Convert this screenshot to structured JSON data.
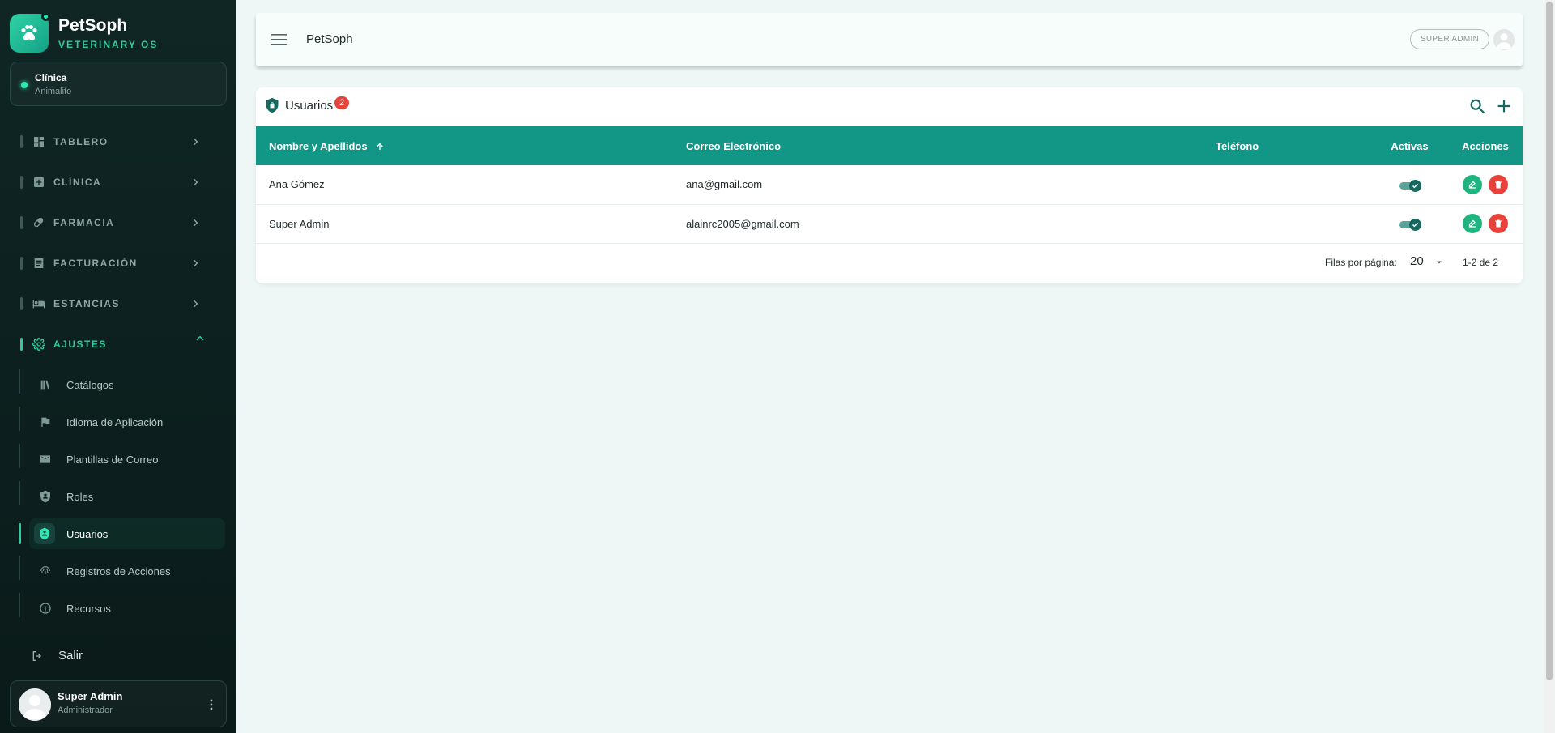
{
  "brand": {
    "title": "PetSoph",
    "subtitle": "VETERINARY OS"
  },
  "clinic": {
    "label": "Clínica",
    "name": "Animalito"
  },
  "nav": [
    {
      "label": "TABLERO",
      "icon": "dashboard-icon"
    },
    {
      "label": "CLÍNICA",
      "icon": "medical-plus-icon"
    },
    {
      "label": "FARMACIA",
      "icon": "pill-icon"
    },
    {
      "label": "FACTURACIÓN",
      "icon": "receipt-icon"
    },
    {
      "label": "ESTANCIAS",
      "icon": "bed-icon"
    },
    {
      "label": "AJUSTES",
      "icon": "gear-icon"
    }
  ],
  "settings_items": [
    {
      "label": "Catálogos",
      "icon": "books-icon"
    },
    {
      "label": "Idioma de Aplicación",
      "icon": "flag-icon"
    },
    {
      "label": "Plantillas de Correo",
      "icon": "mail-template-icon"
    },
    {
      "label": "Roles",
      "icon": "shield-icon"
    },
    {
      "label": "Usuarios",
      "icon": "user-shield-icon"
    },
    {
      "label": "Registros de Acciones",
      "icon": "fingerprint-icon"
    },
    {
      "label": "Recursos",
      "icon": "info-icon"
    }
  ],
  "logout_label": "Salir",
  "user": {
    "name": "Super Admin",
    "role": "Administrador"
  },
  "topbar": {
    "title": "PetSoph",
    "role_chip": "SUPER ADMIN"
  },
  "users_card": {
    "title": "Usuarios",
    "count": "2",
    "columns": [
      "Nombre y Apellidos",
      "Correo Electrónico",
      "Teléfono",
      "Activas",
      "Acciones"
    ],
    "rows": [
      {
        "name": "Ana Gómez",
        "email": "ana@gmail.com",
        "phone": "",
        "active": true
      },
      {
        "name": "Super Admin",
        "email": "alainrc2005@gmail.com",
        "phone": "",
        "active": true
      }
    ],
    "rows_per_page_label": "Filas por página:",
    "rows_per_page": "20",
    "range": "1-2 de 2"
  },
  "colors": {
    "accent": "#2ecc9f",
    "table_header": "#129686",
    "danger": "#e8433b",
    "edit": "#1fb37e"
  }
}
